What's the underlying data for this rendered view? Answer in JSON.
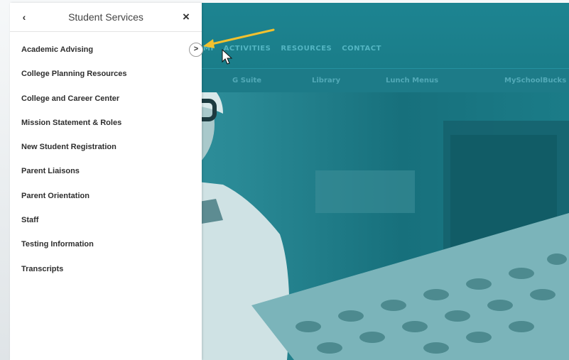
{
  "sidebar": {
    "title": "Student Services",
    "back_icon": "chevron-left-icon",
    "close_icon": "close-icon",
    "items": [
      {
        "label": "Academic Advising",
        "has_submenu": true
      },
      {
        "label": "College Planning Resources"
      },
      {
        "label": "College and Career Center"
      },
      {
        "label": "Mission Statement & Roles"
      },
      {
        "label": "New Student Registration"
      },
      {
        "label": "Parent Liaisons"
      },
      {
        "label": "Parent Orientation"
      },
      {
        "label": "Staff"
      },
      {
        "label": "Testing Information"
      },
      {
        "label": "Transcripts"
      }
    ],
    "expand_glyph": ">"
  },
  "site": {
    "main_nav": [
      "MI",
      "ACTIVITIES",
      "RESOURCES",
      "CONTACT"
    ],
    "sub_nav": [
      "G Suite",
      "Library",
      "Lunch Menus",
      "MySchoolBucks"
    ]
  },
  "colors": {
    "header_teal": "#1d8491",
    "annotation_arrow": "#f2c12e"
  }
}
